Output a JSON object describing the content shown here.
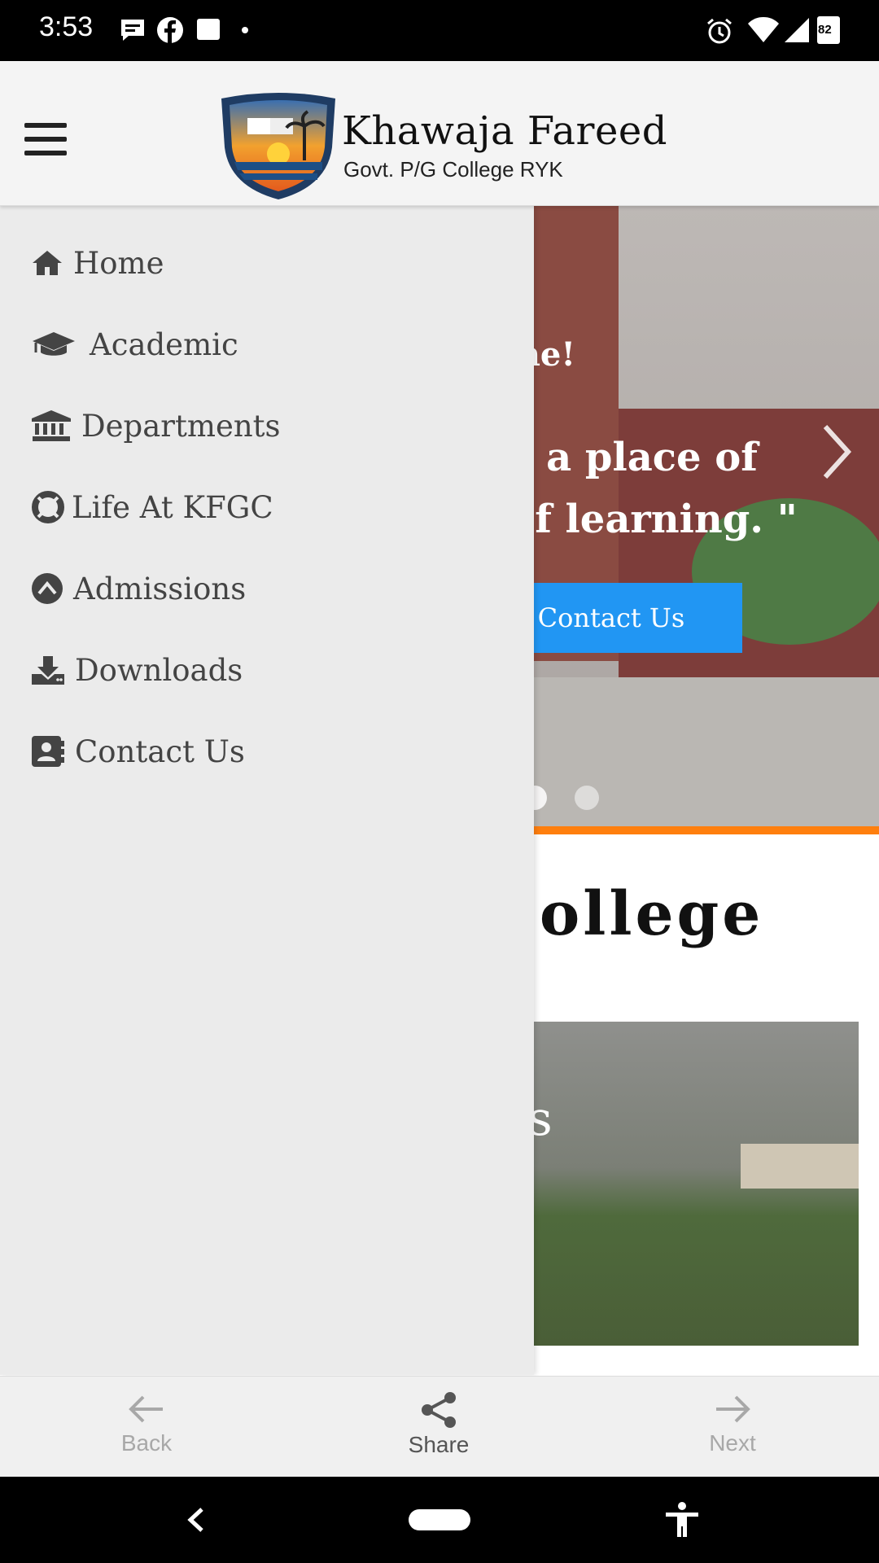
{
  "status_bar": {
    "time": "3:53",
    "battery": "82"
  },
  "header": {
    "brand_title": "Khawaja Fareed",
    "brand_subtitle": "Govt. P/G College RYK"
  },
  "hero": {
    "greeting": "One!",
    "quote_line1": "d be a place of",
    "quote_line2": "nd of learning. \"",
    "cta_label": "Contact Us"
  },
  "content": {
    "section_title": "College",
    "photo_caption": "Us"
  },
  "drawer": {
    "items": [
      {
        "label": "Home",
        "icon": "home-icon"
      },
      {
        "label": "Academic",
        "icon": "graduation-cap-icon"
      },
      {
        "label": "Departments",
        "icon": "institution-icon"
      },
      {
        "label": "Life At KFGC",
        "icon": "life-ring-icon"
      },
      {
        "label": "Admissions",
        "icon": "caret-up-circle-icon"
      },
      {
        "label": "Downloads",
        "icon": "download-icon"
      },
      {
        "label": "Contact Us",
        "icon": "address-book-icon"
      }
    ]
  },
  "bottom_bar": {
    "back_label": "Back",
    "share_label": "Share",
    "next_label": "Next"
  },
  "colors": {
    "accent_blue": "#2196f3",
    "accent_orange": "#ff7f0e",
    "drawer_bg": "#ebebeb",
    "menu_text": "#444444"
  }
}
